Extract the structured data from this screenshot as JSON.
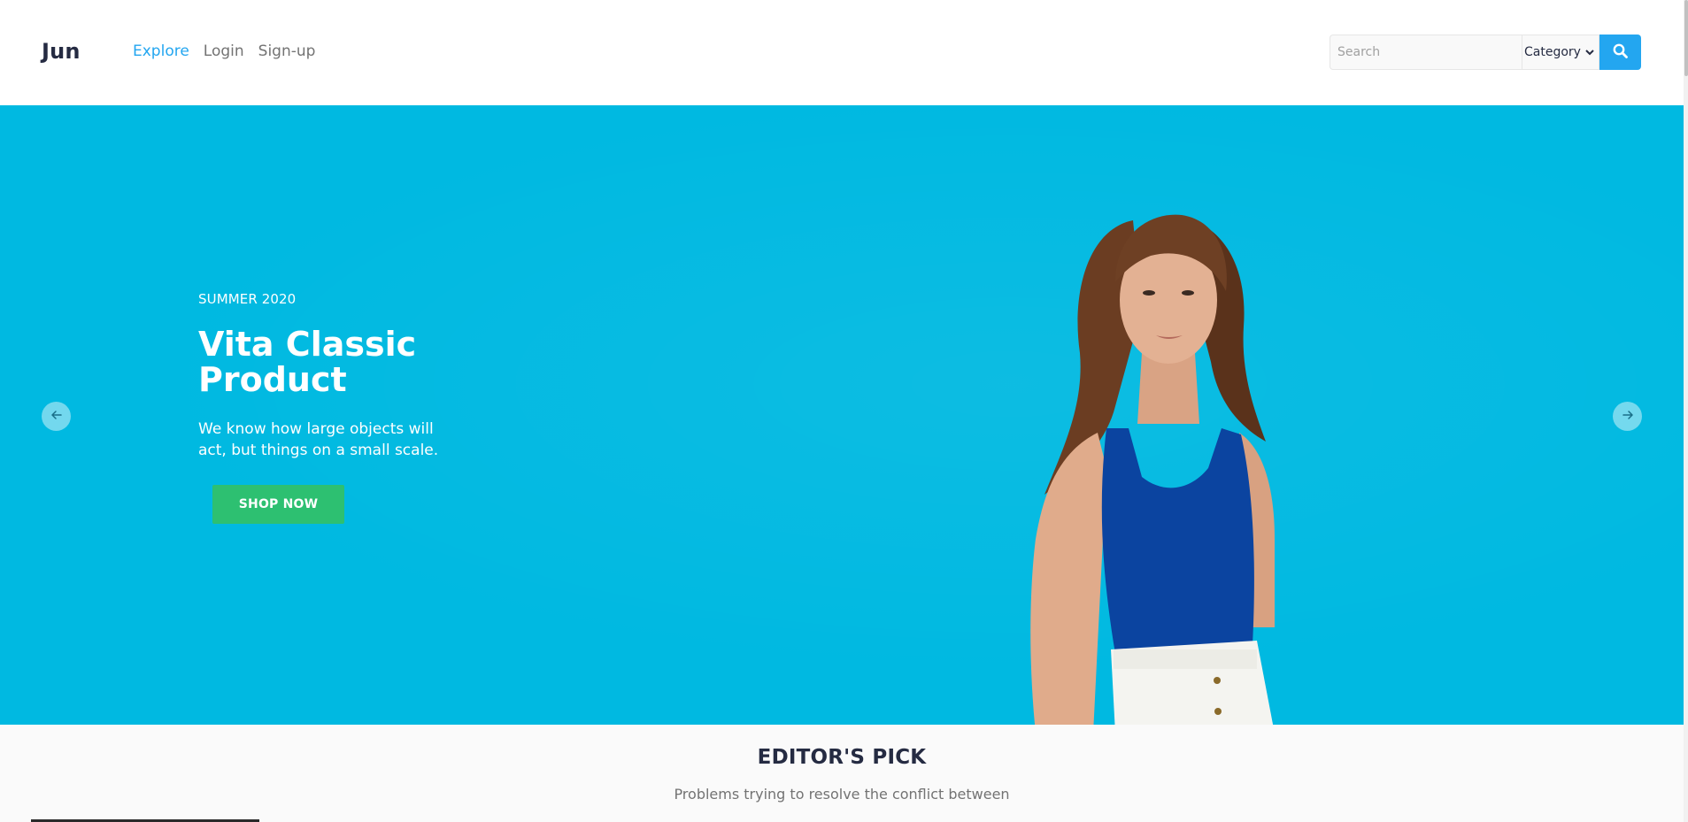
{
  "header": {
    "logo": "Jun",
    "nav": [
      {
        "label": "Explore",
        "active": true
      },
      {
        "label": "Login",
        "active": false
      },
      {
        "label": "Sign-up",
        "active": false
      }
    ],
    "search": {
      "placeholder": "Search",
      "category": "Category"
    }
  },
  "hero": {
    "season": "SUMMER 2020",
    "title": "Vita Classic Product",
    "description": "We know how large objects will act, but things on a small scale.",
    "button_label": "SHOP NOW",
    "background_color": "#00b9e1",
    "button_color": "#2dc071"
  },
  "editors_pick": {
    "title": "EDITOR'S PICK",
    "subtitle": "Problems trying to resolve the conflict between"
  },
  "icons": {
    "search": "search-icon",
    "prev": "arrow-left-icon",
    "next": "arrow-right-icon"
  },
  "colors": {
    "accent": "#23a6f0",
    "text_dark": "#252b42",
    "text_muted": "#737373"
  }
}
